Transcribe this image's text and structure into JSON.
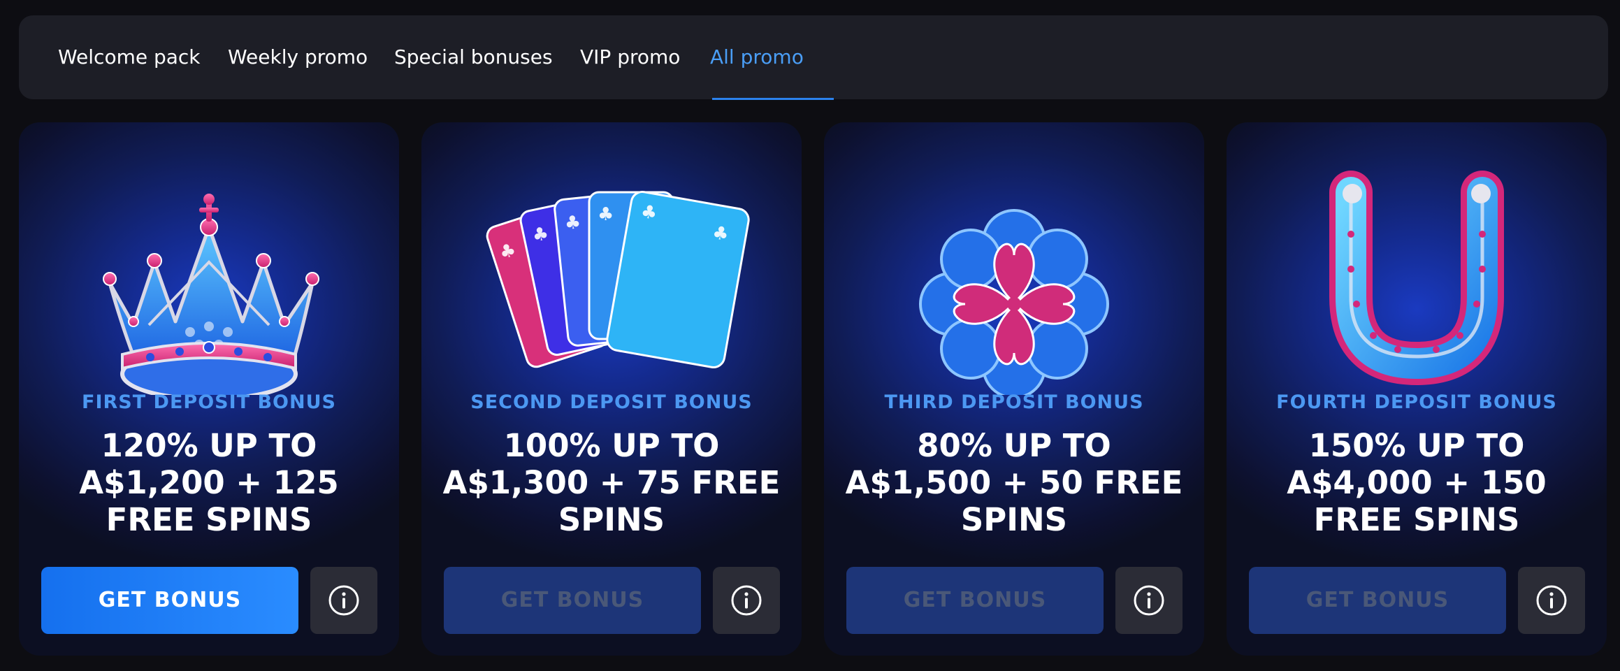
{
  "tabs": [
    {
      "label": "Welcome pack",
      "active": false
    },
    {
      "label": "Weekly promo",
      "active": false
    },
    {
      "label": "Special bonuses",
      "active": false
    },
    {
      "label": "VIP promo",
      "active": false
    },
    {
      "label": "All promo",
      "active": true
    }
  ],
  "cards": [
    {
      "icon": "crown-icon",
      "label": "FIRST DEPOSIT BONUS",
      "offer": "120% UP TO A$1,200 + 125 FREE SPINS",
      "button": "GET BONUS",
      "button_state": "enabled"
    },
    {
      "icon": "playing-cards-icon",
      "label": "SECOND DEPOSIT BONUS",
      "offer": "100% UP TO A$1,300 + 75 FREE SPINS",
      "button": "GET BONUS",
      "button_state": "disabled"
    },
    {
      "icon": "clover-icon",
      "label": "THIRD DEPOSIT BONUS",
      "offer": "80% UP TO A$1,500 + 50 FREE SPINS",
      "button": "GET BONUS",
      "button_state": "disabled"
    },
    {
      "icon": "horseshoe-icon",
      "label": "FOURTH DEPOSIT BONUS",
      "offer": "150% UP TO A$4,000 + 150 FREE SPINS",
      "button": "GET BONUS",
      "button_state": "disabled"
    }
  ],
  "colors": {
    "accent": "#4a9ef6",
    "button_primary": "#1f7cf6",
    "button_disabled": "#1d3578",
    "card_label": "#4c98f2",
    "page_background": "#0d0d12"
  }
}
